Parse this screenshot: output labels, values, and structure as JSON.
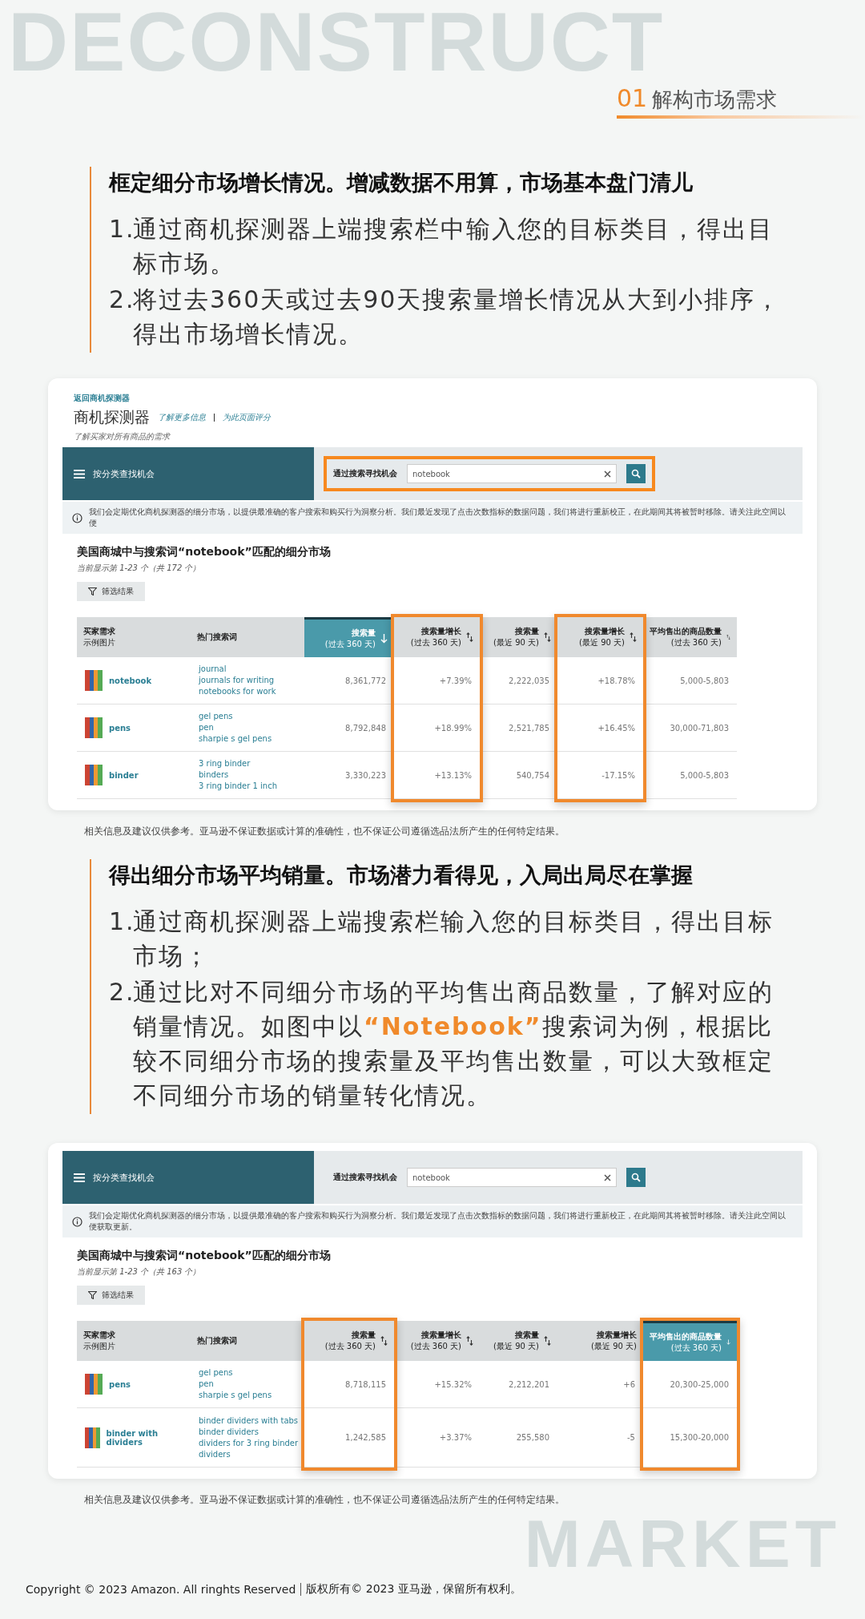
{
  "header": {
    "watermark": "DECONSTRUCT",
    "section_number": "01",
    "section_title": "解构市场需求"
  },
  "sections": [
    {
      "heading": "框定细分市场增长情况。增减数据不用算，市场基本盘门清儿",
      "items": [
        {
          "number": "1.",
          "segments": [
            {
              "text": "通过商机探测器上端搜索栏中输入您的目标类目，得出目标市场。",
              "emphasis": false
            }
          ]
        },
        {
          "number": "2.",
          "segments": [
            {
              "text": "将过去360天或过去90天搜索量增长情况从大到小排序，得出市场增长情况。",
              "emphasis": false
            }
          ]
        }
      ],
      "screenshot": {
        "app_header": {
          "back_link": "返回商机探测器",
          "title": "商机探测器",
          "links": [
            "了解更多信息",
            "为此页面评分"
          ],
          "subtitle": "了解买家对所有商品的需求"
        },
        "nav": {
          "category_label": "按分类查找机会",
          "search_label": "通过搜索寻找机会",
          "search_value": "notebook",
          "search_highlighted": true
        },
        "notice": "我们会定期优化商机探测器的细分市场，以提供最准确的客户搜索和购买行为洞察分析。我们最近发现了点击次数指标的数据问题，我们将进行重新校正，在此期间其将被暂时移除。请关注此空间以便",
        "results_title": "美国商城中与搜索词“notebook”匹配的细分市场",
        "results_count": "当前显示第 1-23 个（共 172 个）",
        "filter_button": "筛选结果",
        "columns": [
          {
            "label": "买家需求",
            "sublabel": "示例图片",
            "sortable": false,
            "sorted": false,
            "highlighted": false
          },
          {
            "label": "热门搜索词",
            "sortable": false,
            "sorted": false,
            "highlighted": false
          },
          {
            "label": "搜索量",
            "sublabel": "(过去 360 天)",
            "sortable": true,
            "sorted": true,
            "highlighted": false
          },
          {
            "label": "搜索量增长",
            "sublabel": "(过去 360 天)",
            "sortable": true,
            "sorted": false,
            "highlighted": true
          },
          {
            "label": "搜索量",
            "sublabel": "(最近 90 天)",
            "sortable": true,
            "sorted": false,
            "highlighted": false
          },
          {
            "label": "搜索量增长",
            "sublabel": "(最近 90 天)",
            "sortable": true,
            "sorted": false,
            "highlighted": true
          },
          {
            "label": "平均售出的商品数量",
            "sublabel": "(过去 360 天)",
            "sortable": true,
            "sorted": false,
            "highlighted": false
          }
        ],
        "rows": [
          {
            "segment": "notebook",
            "terms": [
              "journal",
              "journals for writing",
              "notebooks for work"
            ],
            "values": [
              "8,361,772",
              "+7.39%",
              "2,222,035",
              "+18.78%",
              "5,000-5,803"
            ]
          },
          {
            "segment": "pens",
            "terms": [
              "gel pens",
              "pen",
              "sharpie s gel pens"
            ],
            "values": [
              "8,792,848",
              "+18.99%",
              "2,521,785",
              "+16.45%",
              "30,000-71,803"
            ]
          },
          {
            "segment": "binder",
            "terms": [
              "3 ring binder",
              "binders",
              "3 ring binder 1 inch"
            ],
            "values": [
              "3,330,223",
              "+13.13%",
              "540,754",
              "-17.15%",
              "5,000-5,803"
            ]
          }
        ]
      },
      "disclaimer": "相关信息及建议仅供参考。亚马逊不保证数据或计算的准确性，也不保证公司遵循选品法所产生的任何特定结果。"
    },
    {
      "heading": "得出细分市场平均销量。市场潜力看得见，入局出局尽在掌握",
      "items": [
        {
          "number": "1.",
          "segments": [
            {
              "text": "通过商机探测器上端搜索栏输入您的目标类目，得出目标市场；",
              "emphasis": false
            }
          ]
        },
        {
          "number": "2.",
          "segments": [
            {
              "text": "通过比对不同细分市场的平均售出商品数量，了解对应的销量情况。如图中以",
              "emphasis": false
            },
            {
              "text": "“Notebook”",
              "emphasis": true
            },
            {
              "text": "搜索词为例，根据比较不同细分市场的搜索量及平均售出数量，可以大致框定不同细分市场的销量转化情况。",
              "emphasis": false
            }
          ]
        }
      ],
      "screenshot": {
        "nav": {
          "category_label": "按分类查找机会",
          "search_label": "通过搜索寻找机会",
          "search_value": "notebook",
          "search_highlighted": false
        },
        "notice": "我们会定期优化商机探测器的细分市场，以提供最准确的客户搜索和购买行为洞察分析。我们最近发现了点击次数指标的数据问题，我们将进行重新校正，在此期间其将被暂时移除。请关注此空间以便获取更新。",
        "results_title": "美国商城中与搜索词“notebook”匹配的细分市场",
        "results_count": "当前显示第 1-23 个（共 163 个）",
        "filter_button": "筛选结果",
        "columns": [
          {
            "label": "买家需求",
            "sublabel": "示例图片",
            "sortable": false,
            "sorted": false,
            "highlighted": false
          },
          {
            "label": "热门搜索词",
            "sortable": false,
            "sorted": false,
            "highlighted": false
          },
          {
            "label": "搜索量",
            "sublabel": "(过去 360 天)",
            "sortable": true,
            "sorted": false,
            "highlighted": true
          },
          {
            "label": "搜索量增长",
            "sublabel": "(过去 360 天)",
            "sortable": true,
            "sorted": false,
            "highlighted": false
          },
          {
            "label": "搜索量",
            "sublabel": "(最近 90 天)",
            "sortable": true,
            "sorted": false,
            "highlighted": false
          },
          {
            "label": "搜索量增长",
            "sublabel": "(最近 90 天)",
            "sortable": false,
            "sorted": false,
            "highlighted": false
          },
          {
            "label": "平均售出的商品数量",
            "sublabel": "(过去 360 天)",
            "sortable": true,
            "sorted": true,
            "highlighted": true
          }
        ],
        "rows": [
          {
            "segment": "pens",
            "terms": [
              "gel pens",
              "pen",
              "sharpie s gel pens"
            ],
            "values": [
              "8,718,115",
              "+15.32%",
              "2,212,201",
              "+6",
              "20,300-25,000"
            ]
          },
          {
            "segment": "binder with dividers",
            "terms": [
              "binder dividers with tabs",
              "binder dividers",
              "dividers for 3 ring binder",
              "dividers"
            ],
            "values": [
              "1,242,585",
              "+3.37%",
              "255,580",
              "-5",
              "15,300-20,000"
            ]
          }
        ]
      },
      "disclaimer": "相关信息及建议仅供参考。亚马逊不保证数据或计算的准确性，也不保证公司遵循选品法所产生的任何特定结果。"
    }
  ],
  "footer": {
    "watermark": "MARKET",
    "copyright_en": "Copyright © 2023 Amazon. All ringhts Reserved",
    "copyright_cn": "版权所有© 2023 亚马逊，保留所有权利。"
  }
}
